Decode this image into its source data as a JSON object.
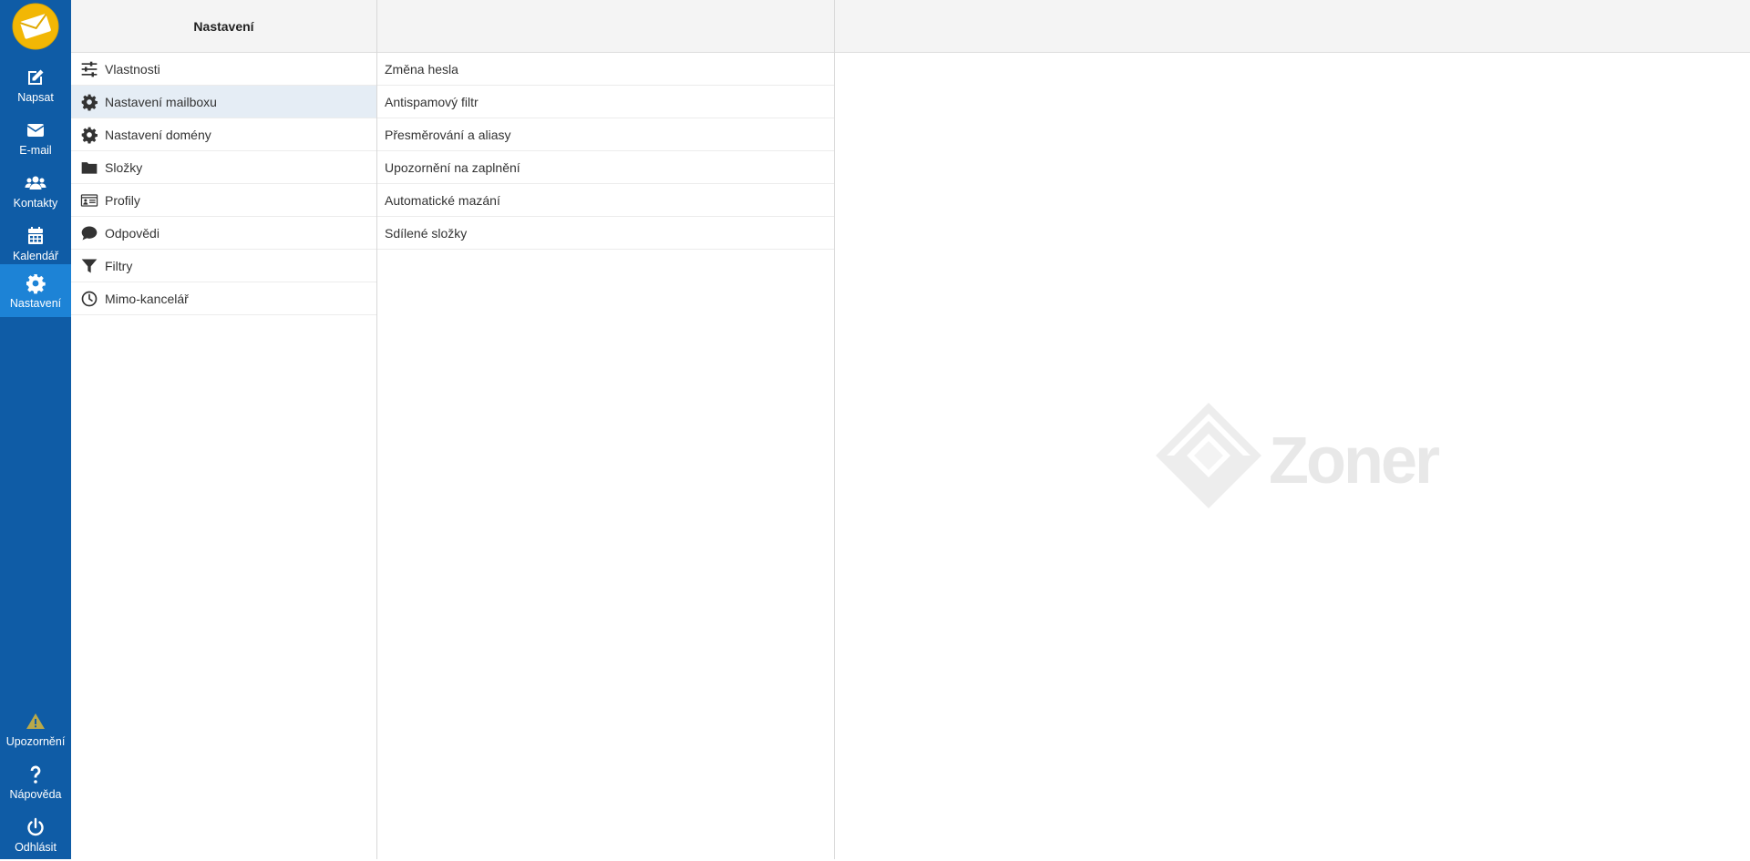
{
  "taskmenu": {
    "compose": "Napsat",
    "mail": "E-mail",
    "contacts": "Kontakty",
    "calendar": "Kalendář",
    "settings": "Nastavení",
    "notifications": "Upozornění",
    "help": "Nápověda",
    "logout": "Odhlásit"
  },
  "settings_panel": {
    "title": "Nastavení",
    "items": [
      {
        "label": "Vlastnosti",
        "icon": "sliders-icon"
      },
      {
        "label": "Nastavení mailboxu",
        "icon": "gear-icon"
      },
      {
        "label": "Nastavení domény",
        "icon": "gear-icon"
      },
      {
        "label": "Složky",
        "icon": "folder-icon"
      },
      {
        "label": "Profily",
        "icon": "id-card-icon"
      },
      {
        "label": "Odpovědi",
        "icon": "comment-icon"
      },
      {
        "label": "Filtry",
        "icon": "filter-icon"
      },
      {
        "label": "Mimo-kancelář",
        "icon": "clock-icon"
      }
    ]
  },
  "sections_panel": {
    "items": [
      "Změna hesla",
      "Antispamový filtr",
      "Přesměrování a aliasy",
      "Upozornění na zaplnění",
      "Automatické mazání",
      "Sdílené složky"
    ]
  },
  "content": {
    "watermark": "Zoner"
  },
  "colors": {
    "sidebar": "#0f5ca6",
    "sidebar_selected": "#1d83d6",
    "logo": "#f2b705",
    "row_selected": "#e5edf5"
  }
}
